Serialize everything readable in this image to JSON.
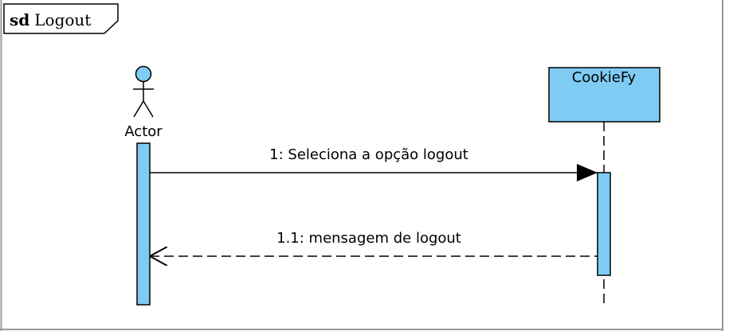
{
  "frame": {
    "keyword": "sd",
    "name": "Logout"
  },
  "actor": {
    "name": "Actor"
  },
  "lifeline": {
    "name": "CookieFy"
  },
  "messages": [
    {
      "label": "1: Seleciona a opção logout",
      "kind": "synchronous"
    },
    {
      "label": "1.1: mensagem de logout",
      "kind": "reply"
    }
  ],
  "colors": {
    "fill": "#7ecbf4",
    "stroke": "#000000",
    "background": "#ffffff"
  }
}
